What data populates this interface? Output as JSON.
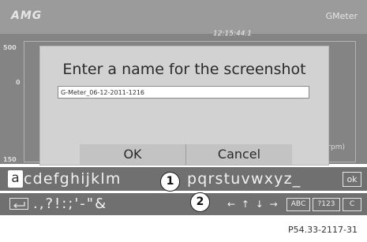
{
  "header": {
    "logo": "AMG",
    "title": "GMeter"
  },
  "graph": {
    "time": "12:15:44.1",
    "axis_top": "500",
    "axis_mid": "0",
    "axis_bottom": "150",
    "unit": "(rpm)"
  },
  "dialog": {
    "title": "Enter a name for the screenshot",
    "name_value": "G-Meter_06-12-2011-1216",
    "ok_label": "OK",
    "cancel_label": "Cancel"
  },
  "keyboard": {
    "selected_letter": "a",
    "letters_left": "cdefghijklm",
    "letters_right": "pqrstuvwxyz",
    "letters_right_suffix": "_",
    "ok_label": "ok",
    "symbols": ".,?!:;'-\"&",
    "arrows": "← ↑ ↓ →",
    "abc_label": "ABC",
    "num_label": "?123",
    "clear_label": "C"
  },
  "callouts": {
    "one": "1",
    "two": "2"
  },
  "reference": "P54.33-2117-31"
}
